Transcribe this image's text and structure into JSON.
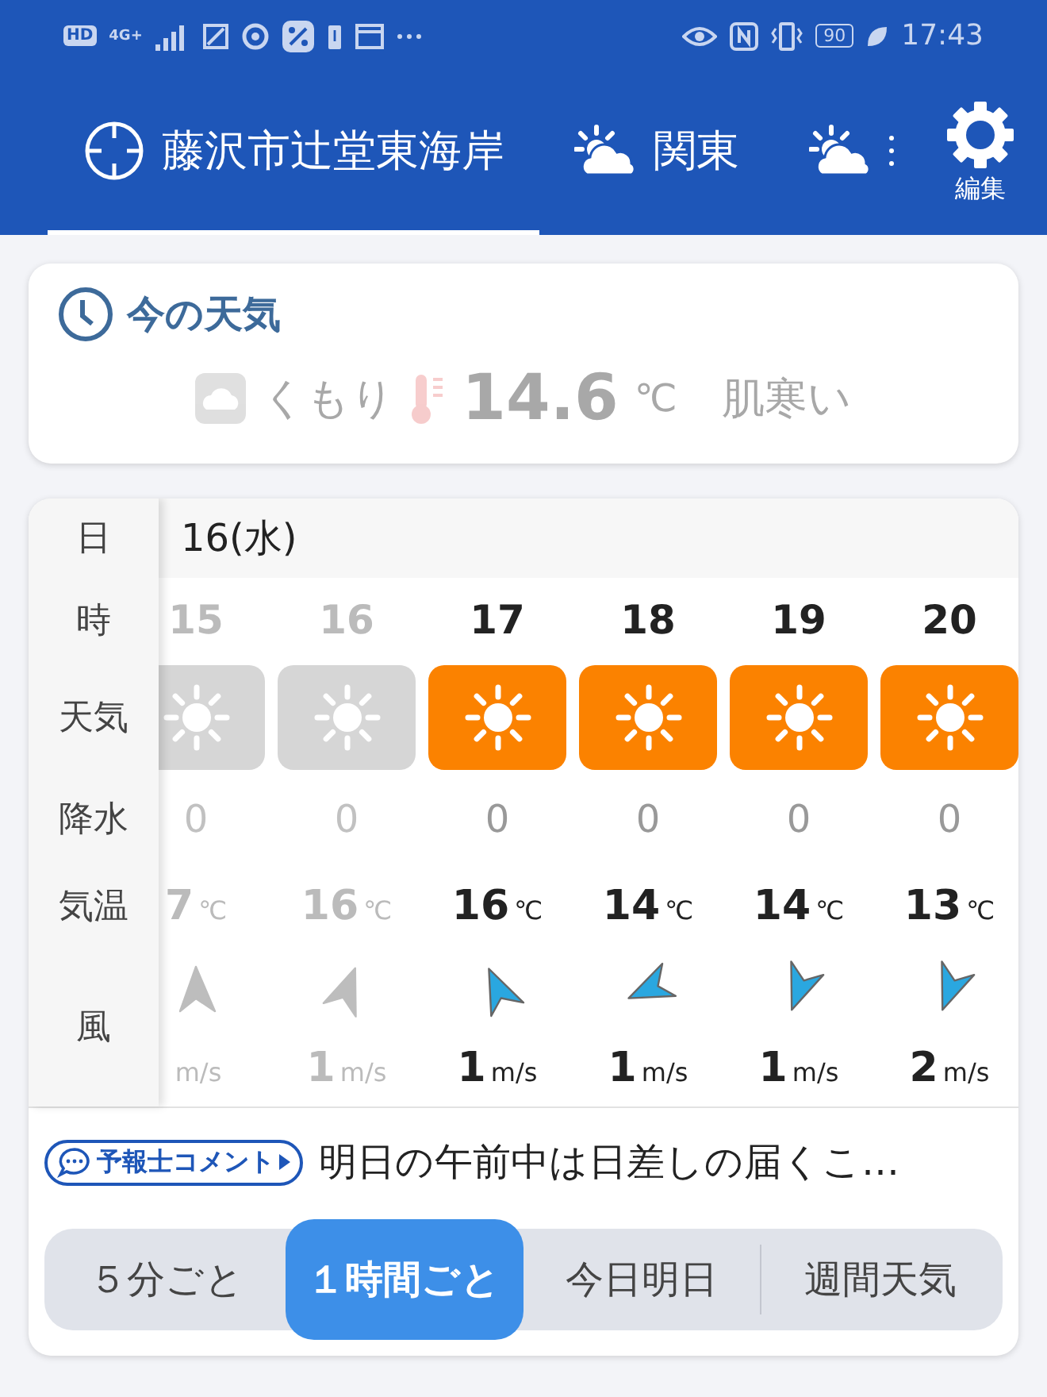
{
  "status_bar": {
    "hd": "HD",
    "network": "4G+",
    "battery": "90",
    "time": "17:43"
  },
  "header": {
    "tabs": [
      {
        "kind": "location",
        "label": "藤沢市辻堂東海岸",
        "selected": true
      },
      {
        "kind": "region",
        "label": "関東",
        "selected": false
      },
      {
        "kind": "more",
        "selected": false
      }
    ],
    "settings_label": "編集"
  },
  "current": {
    "title": "今の天気",
    "condition": "くもり",
    "temperature": "14.6",
    "unit": "℃",
    "feeling": "肌寒い",
    "dimmed": true
  },
  "hourly": {
    "row_labels": [
      "日",
      "時",
      "天気",
      "降水",
      "気温",
      "風"
    ],
    "date": "16(水)",
    "columns": [
      {
        "hour": "15",
        "past": true,
        "weather": {
          "kind": "sunny"
        },
        "precip": "0",
        "temp": "7",
        "temp_unit": "℃",
        "wind": {
          "kind": "n"
        },
        "speed_unit": "m/s"
      },
      {
        "hour": "16",
        "past": true,
        "weather": {
          "kind": "sunny"
        },
        "precip": "0",
        "temp": "16",
        "temp_unit": "℃",
        "wind": {
          "kind": "nne"
        },
        "speed": "1",
        "speed_unit": "m/s"
      },
      {
        "hour": "17",
        "past": false,
        "weather": {
          "kind": "sunny"
        },
        "precip": "0",
        "temp": "16",
        "temp_unit": "℃",
        "wind": {
          "kind": "nnw"
        },
        "speed": "1",
        "speed_unit": "m/s"
      },
      {
        "hour": "18",
        "past": false,
        "weather": {
          "kind": "sunny"
        },
        "precip": "0",
        "temp": "14",
        "temp_unit": "℃",
        "wind": {
          "kind": "wsw"
        },
        "speed": "1",
        "speed_unit": "m/s"
      },
      {
        "hour": "19",
        "past": false,
        "weather": {
          "kind": "sunny"
        },
        "precip": "0",
        "temp": "14",
        "temp_unit": "℃",
        "wind": {
          "kind": "ssw"
        },
        "speed": "1",
        "speed_unit": "m/s"
      },
      {
        "hour": "20",
        "past": false,
        "weather": {
          "kind": "sunny"
        },
        "precip": "0",
        "temp": "13",
        "temp_unit": "℃",
        "wind": {
          "kind": "ssw"
        },
        "speed": "2",
        "speed_unit": "m/s"
      }
    ]
  },
  "comment": {
    "badge": "予報士コメント",
    "text": "明日の午前中は日差しの届くこ…"
  },
  "modes": [
    {
      "label": "５分ごと",
      "selected": false
    },
    {
      "label": "１時間ごと",
      "selected": true
    },
    {
      "label": "今日明日",
      "selected": false
    },
    {
      "label": "週間天気",
      "selected": false
    }
  ]
}
